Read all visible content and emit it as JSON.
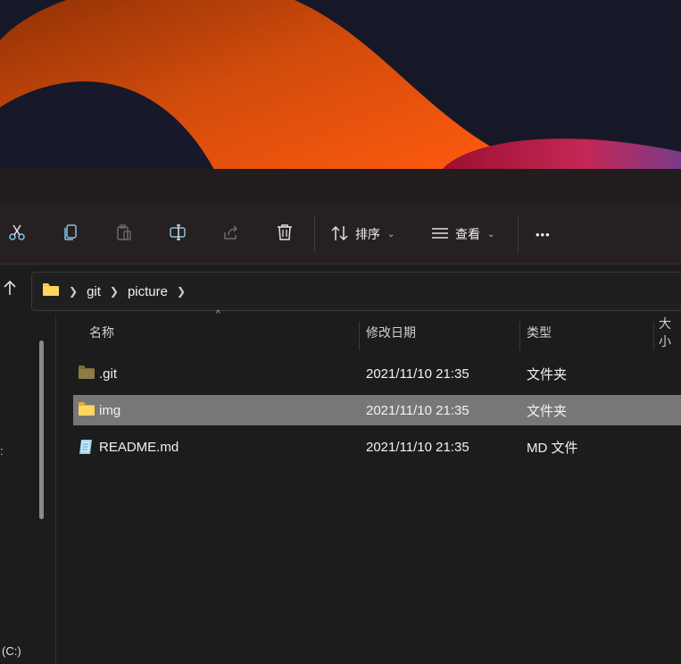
{
  "toolbar": {
    "cut_icon": "scissors-icon",
    "copy_icon": "copy-icon",
    "paste_icon": "clipboard-icon",
    "rename_icon": "rename-icon",
    "share_icon": "share-icon",
    "delete_icon": "trash-icon",
    "sort_label": "排序",
    "view_label": "查看",
    "more_label": "•••"
  },
  "breadcrumb": {
    "items": [
      "git",
      "picture"
    ]
  },
  "columns": {
    "name": "名称",
    "date": "修改日期",
    "type": "类型",
    "size": "大小"
  },
  "files": [
    {
      "name": ".git",
      "date": "2021/11/10 21:35",
      "type": "文件夹",
      "icon": "folder-dark-icon",
      "selected": false
    },
    {
      "name": "img",
      "date": "2021/11/10 21:35",
      "type": "文件夹",
      "icon": "folder-icon",
      "selected": true
    },
    {
      "name": "README.md",
      "date": "2021/11/10 21:35",
      "type": "MD 文件",
      "icon": "md-file-icon",
      "selected": false
    }
  ],
  "leftpane": {
    "drive_label": "(C:)"
  },
  "colors": {
    "accent_orange": "#e8560f",
    "folder_yellow": "#f3c94c",
    "selection_gray": "#777777"
  }
}
